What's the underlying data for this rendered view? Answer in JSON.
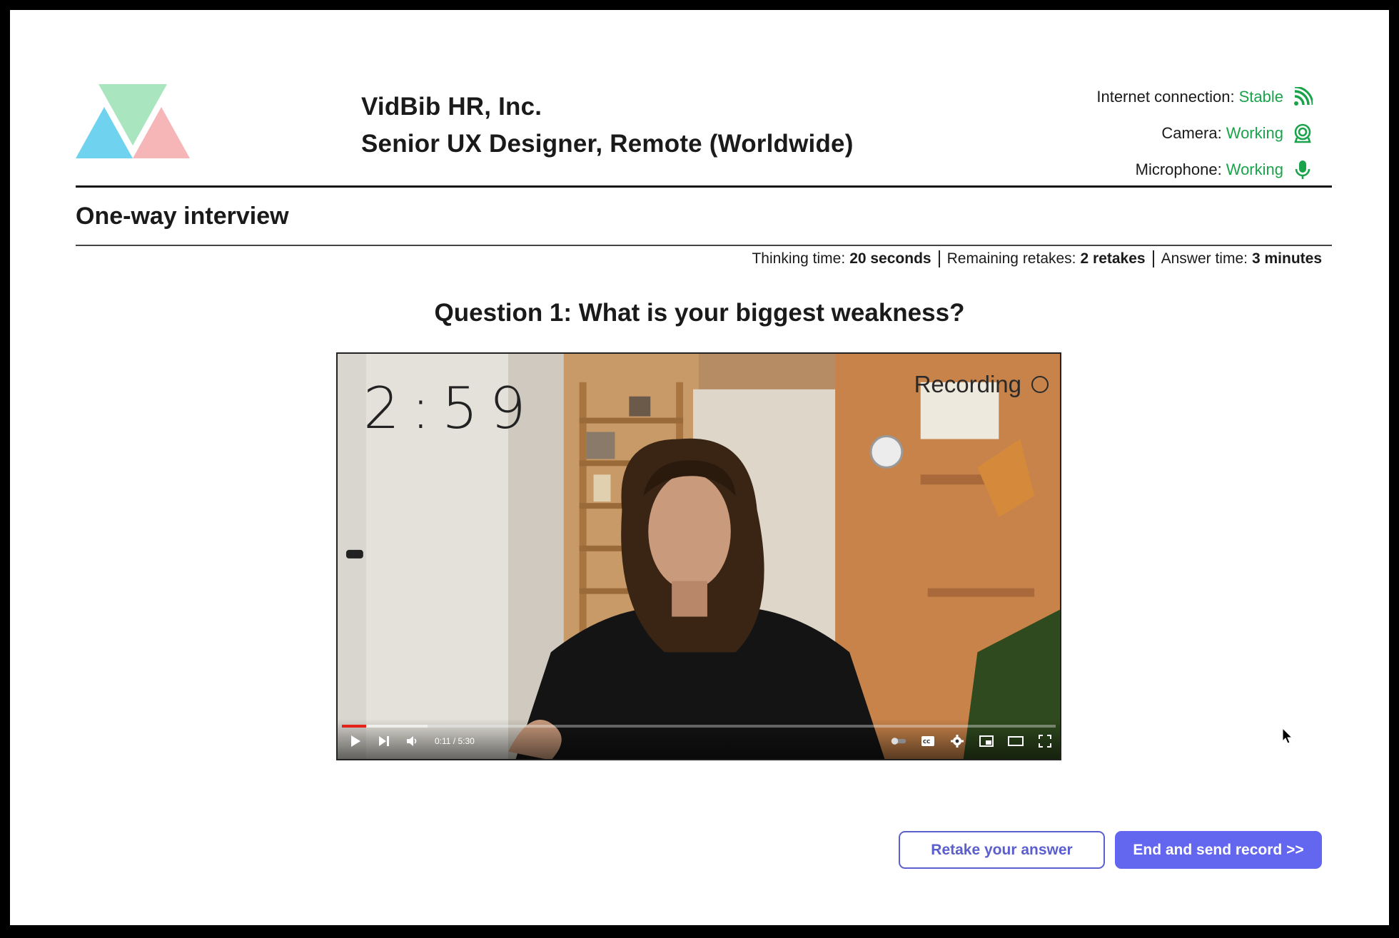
{
  "header": {
    "company": "VidBib HR, Inc.",
    "position": "Senior UX Designer, Remote (Worldwide)"
  },
  "status": {
    "internet_label": "Internet connection:",
    "internet_value": "Stable",
    "camera_label": "Camera:",
    "camera_value": "Working",
    "microphone_label": "Microphone:",
    "microphone_value": "Working",
    "ok_color": "#1aa34a"
  },
  "section_title": "One-way interview",
  "meta": {
    "thinking_label": "Thinking time:",
    "thinking_value": "20 seconds",
    "retakes_label": "Remaining retakes:",
    "retakes_value": "2 retakes",
    "answer_label": "Answer time:",
    "answer_value": "3 minutes"
  },
  "question": "Question 1: What is your biggest weakness?",
  "video": {
    "timer": "2:59",
    "recording_label": "Recording",
    "timecode": "0:11 / 5:30",
    "progress_fraction": 0.034
  },
  "buttons": {
    "retake": "Retake your answer",
    "send": "End and send record >>",
    "accent": "#6366ee"
  },
  "icons": [
    "logo",
    "wifi-icon",
    "webcam-icon",
    "microphone-icon",
    "play-icon",
    "next-icon",
    "volume-icon",
    "autoplay-toggle-icon",
    "captions-icon",
    "settings-icon",
    "miniplayer-icon",
    "theater-icon",
    "fullscreen-icon",
    "cursor-icon"
  ]
}
